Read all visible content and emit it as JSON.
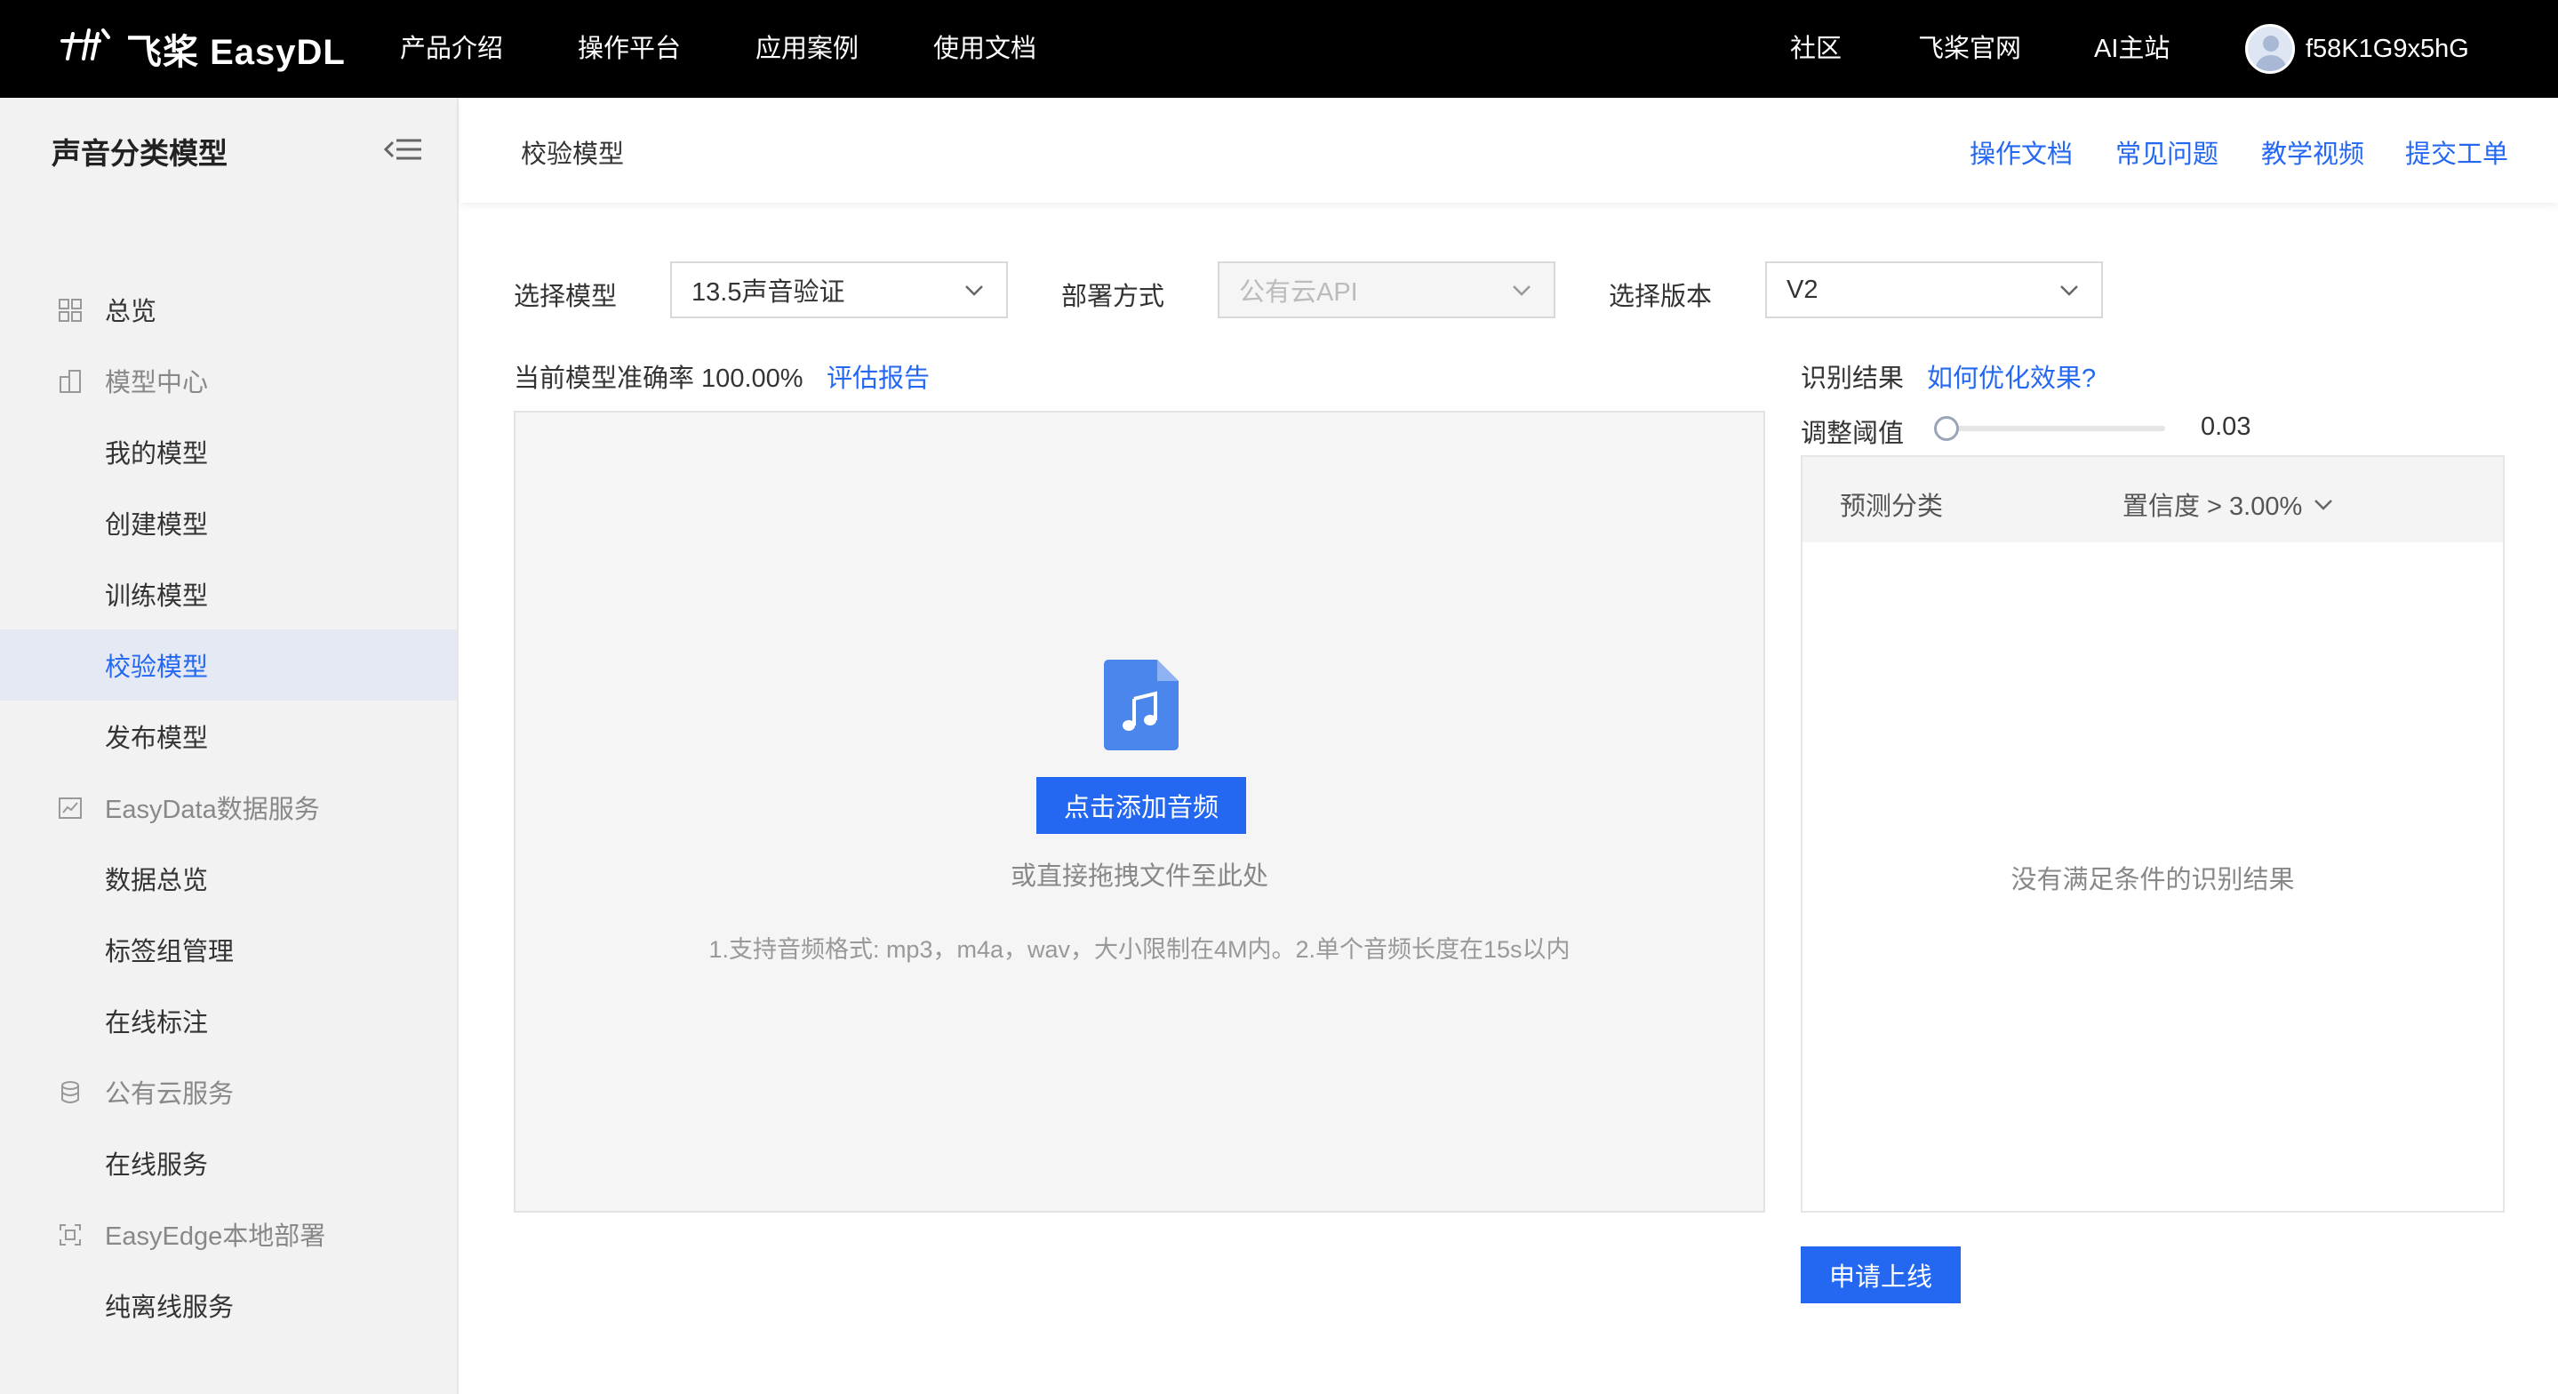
{
  "topnav": {
    "logo_mark": "飞桨",
    "logo_text": "飞桨 EasyDL",
    "items": [
      "产品介绍",
      "操作平台",
      "应用案例",
      "使用文档"
    ],
    "right_items": [
      "社区",
      "飞桨官网",
      "AI主站"
    ],
    "username": "f58K1G9x5hG"
  },
  "sidebar": {
    "title": "声音分类模型",
    "items": [
      {
        "label": "总览",
        "icon": "grid-icon",
        "group": false
      },
      {
        "label": "模型中心",
        "icon": "building-icon",
        "group": true
      },
      {
        "label": "我的模型",
        "group": false
      },
      {
        "label": "创建模型",
        "group": false
      },
      {
        "label": "训练模型",
        "group": false
      },
      {
        "label": "校验模型",
        "group": false,
        "active": true
      },
      {
        "label": "发布模型",
        "group": false
      },
      {
        "label": "EasyData数据服务",
        "icon": "chart-icon",
        "group": true
      },
      {
        "label": "数据总览",
        "group": false
      },
      {
        "label": "标签组管理",
        "group": false
      },
      {
        "label": "在线标注",
        "group": false
      },
      {
        "label": "公有云服务",
        "icon": "database-icon",
        "group": true
      },
      {
        "label": "在线服务",
        "group": false
      },
      {
        "label": "EasyEdge本地部署",
        "icon": "edge-icon",
        "group": true
      },
      {
        "label": "纯离线服务",
        "group": false
      }
    ]
  },
  "header": {
    "title": "校验模型",
    "links": [
      "操作文档",
      "常见问题",
      "教学视频",
      "提交工单"
    ]
  },
  "form": {
    "model_label": "选择模型",
    "model_value": "13.5声音验证",
    "deploy_label": "部署方式",
    "deploy_value": "公有云API",
    "version_label": "选择版本",
    "version_value": "V2"
  },
  "accuracy": {
    "text": "当前模型准确率 100.00%",
    "link": "评估报告"
  },
  "upload": {
    "button": "点击添加音频",
    "drag_hint": "或直接拖拽文件至此处",
    "format_hint": "1.支持音频格式: mp3，m4a，wav，大小限制在4M内。2.单个音频长度在15s以内"
  },
  "result": {
    "label": "识别结果",
    "link": "如何优化效果?",
    "threshold_label": "调整阈值",
    "threshold_value": "0.03",
    "threshold_fraction": 0.03,
    "col_category": "预测分类",
    "col_confidence": "置信度 > 3.00%",
    "empty": "没有满足条件的识别结果",
    "apply_button": "申请上线"
  },
  "colors": {
    "accent": "#2468f2",
    "topnav_bg": "#000000",
    "sidebar_bg": "#f2f2f2",
    "active_bg": "#e4e9f3"
  }
}
